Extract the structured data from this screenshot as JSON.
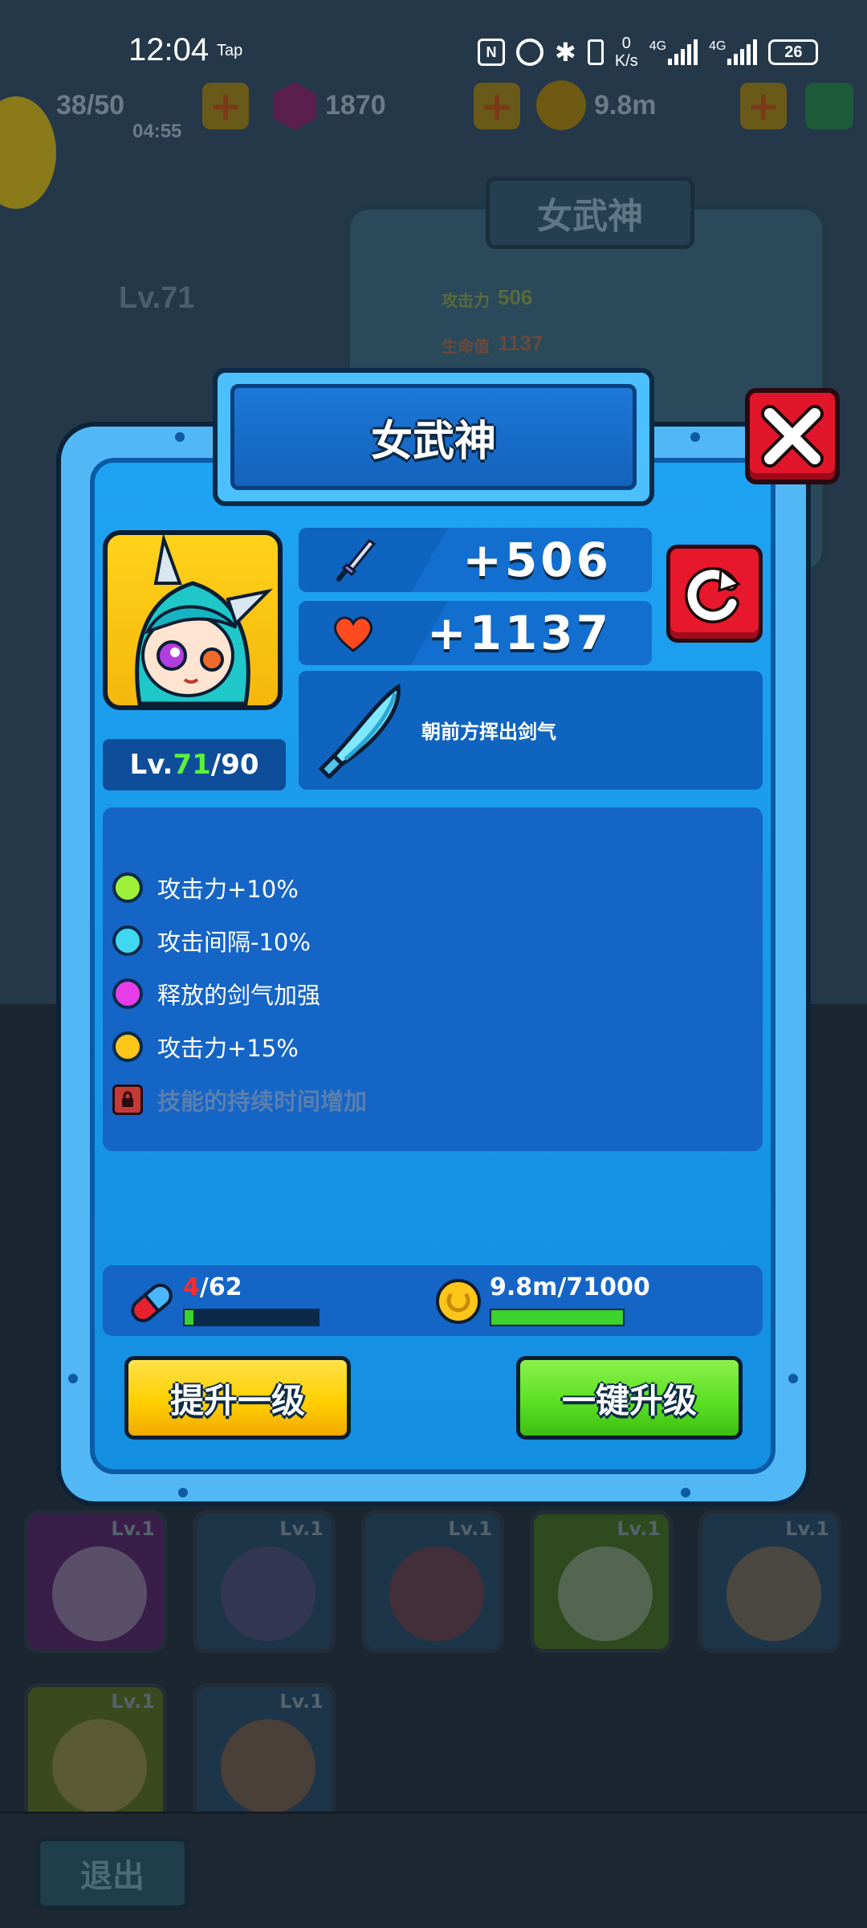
{
  "status_bar": {
    "time": "12:04",
    "tap_label": "Tap",
    "net_speed": "0\nK/s",
    "net_speed_value": "0",
    "net_speed_unit": "K/s",
    "signal1": "4G",
    "signal2": "4G",
    "battery": "26"
  },
  "background": {
    "energy": "38/50",
    "energy_timer": "04:55",
    "gems": "1870",
    "coins": "9.8m",
    "tab_title": "女武神",
    "hero_level": "Lv.71",
    "attack_label": "攻击力",
    "attack_value": "506",
    "hp_label": "生命值",
    "hp_value": "1137",
    "card_level": "Lv.1",
    "exit_label": "退出"
  },
  "modal": {
    "title": "女武神",
    "level_prefix": "Lv.",
    "level_current": "71",
    "level_max": "/90",
    "attack_value": "+506",
    "hp_value": "+1137",
    "skill_description": "朝前方挥出剑气",
    "bonuses": [
      {
        "text": "攻击力+10%",
        "color": "#9ef03a"
      },
      {
        "text": "攻击间隔-10%",
        "color": "#3fd8f0"
      },
      {
        "text": "释放的剑气加强",
        "color": "#e63de8"
      },
      {
        "text": "攻击力+15%",
        "color": "#ffc61a"
      }
    ],
    "locked_bonus": "技能的持续时间增加",
    "pill_current": "4",
    "pill_total": "/62",
    "pill_progress": 0.065,
    "coin_text": "9.8m/71000",
    "coin_progress": 1.0,
    "upgrade_one_label": "提升一级",
    "upgrade_all_label": "一键升级"
  }
}
